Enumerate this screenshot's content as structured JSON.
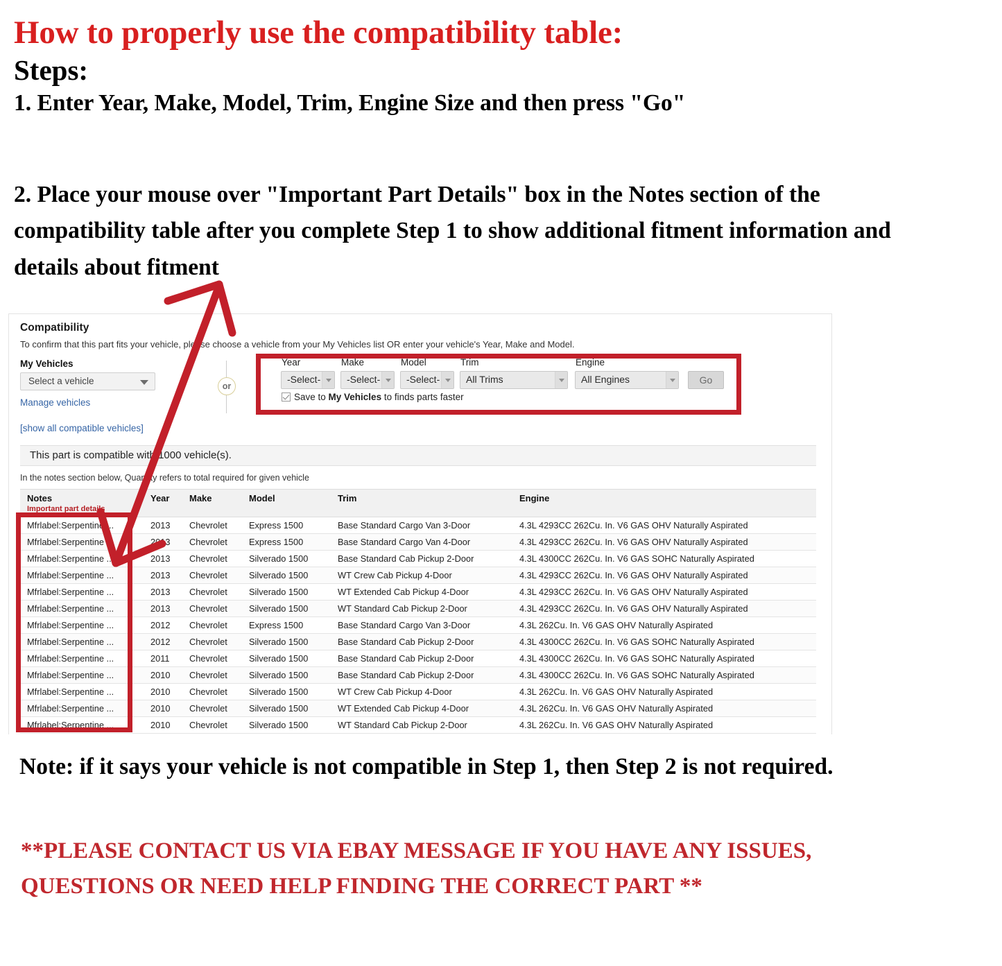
{
  "headline": {
    "title": "How to properly use the compatibility table:",
    "steps_label": "Steps:",
    "step1": "1. Enter Year, Make, Model, Trim, Engine Size and then press \"Go\"",
    "step2": "2. Place your mouse over \"Important Part Details\" box in the Notes section of the compatibility table after you complete Step 1 to show additional fitment information and details about fitment"
  },
  "panel": {
    "title": "Compatibility",
    "subtitle": "To confirm that this part fits your vehicle, please choose a vehicle from your My Vehicles list OR enter your vehicle's Year, Make and Model.",
    "my_vehicles_label": "My Vehicles",
    "vehicle_select_value": "Select a vehicle",
    "manage_vehicles_link": "Manage vehicles",
    "show_all_link": "[show all compatible vehicles]",
    "or_label": "or",
    "compatible_banner": "This part is compatible with 1000 vehicle(s).",
    "quantity_note": "In the notes section below, Quantity refers to total required for given vehicle"
  },
  "form": {
    "fields": [
      {
        "label": "Year",
        "value": "-Select-"
      },
      {
        "label": "Make",
        "value": "-Select-"
      },
      {
        "label": "Model",
        "value": "-Select-"
      },
      {
        "label": "Trim",
        "value": "All Trims"
      },
      {
        "label": "Engine",
        "value": "All Engines"
      }
    ],
    "go_label": "Go",
    "save_checkbox_checked": true,
    "save_text_1": "Save to ",
    "save_text_bold": "My Vehicles",
    "save_text_2": " to finds parts faster"
  },
  "table": {
    "headers": {
      "notes": "Notes",
      "notes_sub": "Important part details",
      "year": "Year",
      "make": "Make",
      "model": "Model",
      "trim": "Trim",
      "engine": "Engine"
    },
    "rows": [
      {
        "notes": "Mfrlabel:Serpentine ...",
        "year": "2013",
        "make": "Chevrolet",
        "model": "Express 1500",
        "trim": "Base Standard Cargo Van 3-Door",
        "engine": "4.3L 4293CC 262Cu. In. V6 GAS OHV Naturally Aspirated"
      },
      {
        "notes": "Mfrlabel:Serpentine ...",
        "year": "2013",
        "make": "Chevrolet",
        "model": "Express 1500",
        "trim": "Base Standard Cargo Van 4-Door",
        "engine": "4.3L 4293CC 262Cu. In. V6 GAS OHV Naturally Aspirated"
      },
      {
        "notes": "Mfrlabel:Serpentine ...",
        "year": "2013",
        "make": "Chevrolet",
        "model": "Silverado 1500",
        "trim": "Base Standard Cab Pickup 2-Door",
        "engine": "4.3L 4300CC 262Cu. In. V6 GAS SOHC Naturally Aspirated"
      },
      {
        "notes": "Mfrlabel:Serpentine ...",
        "year": "2013",
        "make": "Chevrolet",
        "model": "Silverado 1500",
        "trim": "WT Crew Cab Pickup 4-Door",
        "engine": "4.3L 4293CC 262Cu. In. V6 GAS OHV Naturally Aspirated"
      },
      {
        "notes": "Mfrlabel:Serpentine ...",
        "year": "2013",
        "make": "Chevrolet",
        "model": "Silverado 1500",
        "trim": "WT Extended Cab Pickup 4-Door",
        "engine": "4.3L 4293CC 262Cu. In. V6 GAS OHV Naturally Aspirated"
      },
      {
        "notes": "Mfrlabel:Serpentine ...",
        "year": "2013",
        "make": "Chevrolet",
        "model": "Silverado 1500",
        "trim": "WT Standard Cab Pickup 2-Door",
        "engine": "4.3L 4293CC 262Cu. In. V6 GAS OHV Naturally Aspirated"
      },
      {
        "notes": "Mfrlabel:Serpentine ...",
        "year": "2012",
        "make": "Chevrolet",
        "model": "Express 1500",
        "trim": "Base Standard Cargo Van 3-Door",
        "engine": "4.3L 262Cu. In. V6 GAS OHV Naturally Aspirated"
      },
      {
        "notes": "Mfrlabel:Serpentine ...",
        "year": "2012",
        "make": "Chevrolet",
        "model": "Silverado 1500",
        "trim": "Base Standard Cab Pickup 2-Door",
        "engine": "4.3L 4300CC 262Cu. In. V6 GAS SOHC Naturally Aspirated"
      },
      {
        "notes": "Mfrlabel:Serpentine ...",
        "year": "2011",
        "make": "Chevrolet",
        "model": "Silverado 1500",
        "trim": "Base Standard Cab Pickup 2-Door",
        "engine": "4.3L 4300CC 262Cu. In. V6 GAS SOHC Naturally Aspirated"
      },
      {
        "notes": "Mfrlabel:Serpentine ...",
        "year": "2010",
        "make": "Chevrolet",
        "model": "Silverado 1500",
        "trim": "Base Standard Cab Pickup 2-Door",
        "engine": "4.3L 4300CC 262Cu. In. V6 GAS SOHC Naturally Aspirated"
      },
      {
        "notes": "Mfrlabel:Serpentine ...",
        "year": "2010",
        "make": "Chevrolet",
        "model": "Silverado 1500",
        "trim": "WT Crew Cab Pickup 4-Door",
        "engine": "4.3L 262Cu. In. V6 GAS OHV Naturally Aspirated"
      },
      {
        "notes": "Mfrlabel:Serpentine ...",
        "year": "2010",
        "make": "Chevrolet",
        "model": "Silverado 1500",
        "trim": "WT Extended Cab Pickup 4-Door",
        "engine": "4.3L 262Cu. In. V6 GAS OHV Naturally Aspirated"
      },
      {
        "notes": "Mfrlabel:Serpentine ...",
        "year": "2010",
        "make": "Chevrolet",
        "model": "Silverado 1500",
        "trim": "WT Standard Cab Pickup 2-Door",
        "engine": "4.3L 262Cu. In. V6 GAS OHV Naturally Aspirated"
      }
    ]
  },
  "footer": {
    "note": "Note: if it says your vehicle is not compatible in Step 1, then Step 2 is not required.",
    "contact": "**PLEASE CONTACT US VIA EBAY MESSAGE IF YOU HAVE ANY ISSUES, QUESTIONS OR NEED HELP FINDING THE CORRECT PART **"
  },
  "colors": {
    "headline_red": "#d81f1f",
    "annotation_red": "#c2202a",
    "link_blue": "#3665a6",
    "notes_red": "#b52025"
  }
}
